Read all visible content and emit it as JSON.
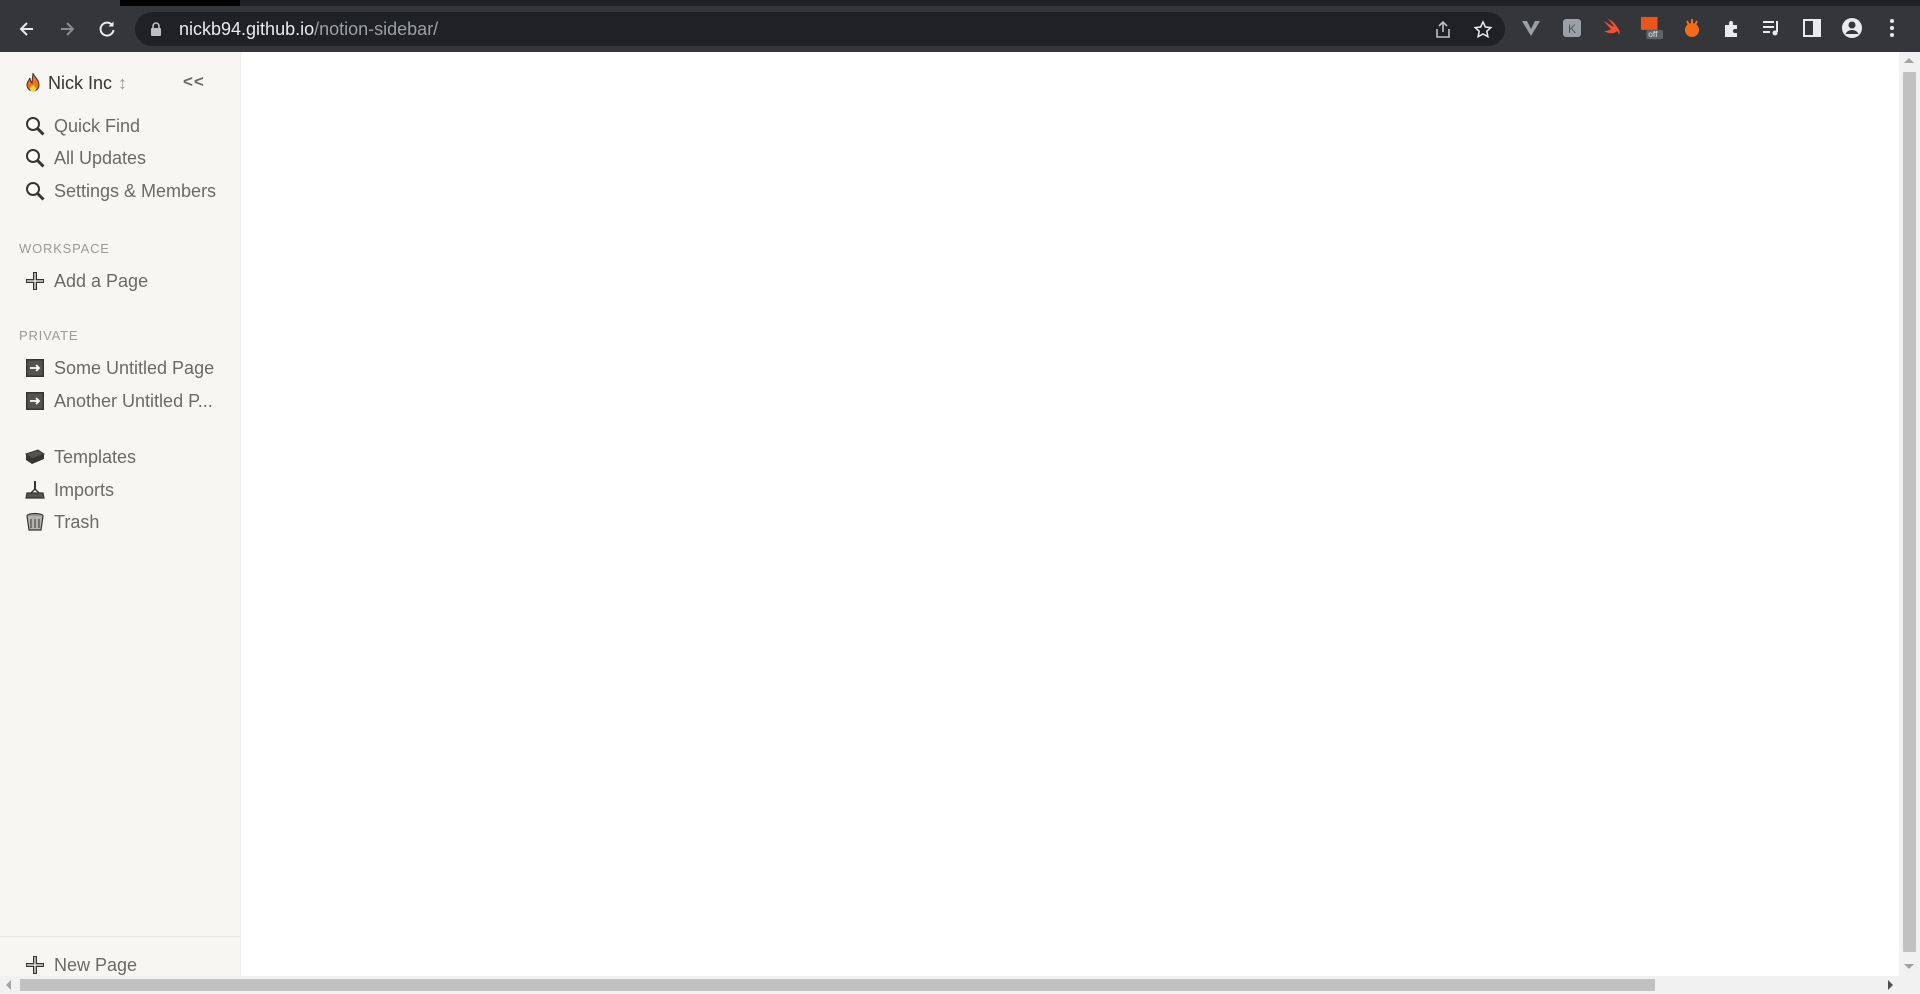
{
  "browser": {
    "url_host": "nickb94.github.io",
    "url_path": "/notion-sidebar/"
  },
  "sidebar": {
    "workspace_name": "Nick Inc",
    "workspace_switch_glyph": "↕",
    "collapse_label": "<<",
    "top_items": [
      {
        "label": "Quick Find",
        "icon": "search-icon"
      },
      {
        "label": "All Updates",
        "icon": "search-icon"
      },
      {
        "label": "Settings & Members",
        "icon": "search-icon"
      }
    ],
    "workspace_section": {
      "label": "WORKSPACE",
      "items": [
        {
          "label": "Add a Page",
          "icon": "plus-icon"
        }
      ]
    },
    "private_section": {
      "label": "PRIVATE",
      "items": [
        {
          "label": "Some Untitled Page",
          "icon": "page-icon"
        },
        {
          "label": "Another Untitled P...",
          "icon": "page-icon"
        }
      ]
    },
    "bottom_items": [
      {
        "label": "Templates",
        "icon": "templates-icon"
      },
      {
        "label": "Imports",
        "icon": "imports-icon"
      },
      {
        "label": "Trash",
        "icon": "trash-icon"
      }
    ],
    "new_page_label": "New Page"
  },
  "colors": {
    "sidebar_bg": "#f7f6f3",
    "sidebar_text": "#6b6a66",
    "chrome_bg": "#35363a"
  }
}
